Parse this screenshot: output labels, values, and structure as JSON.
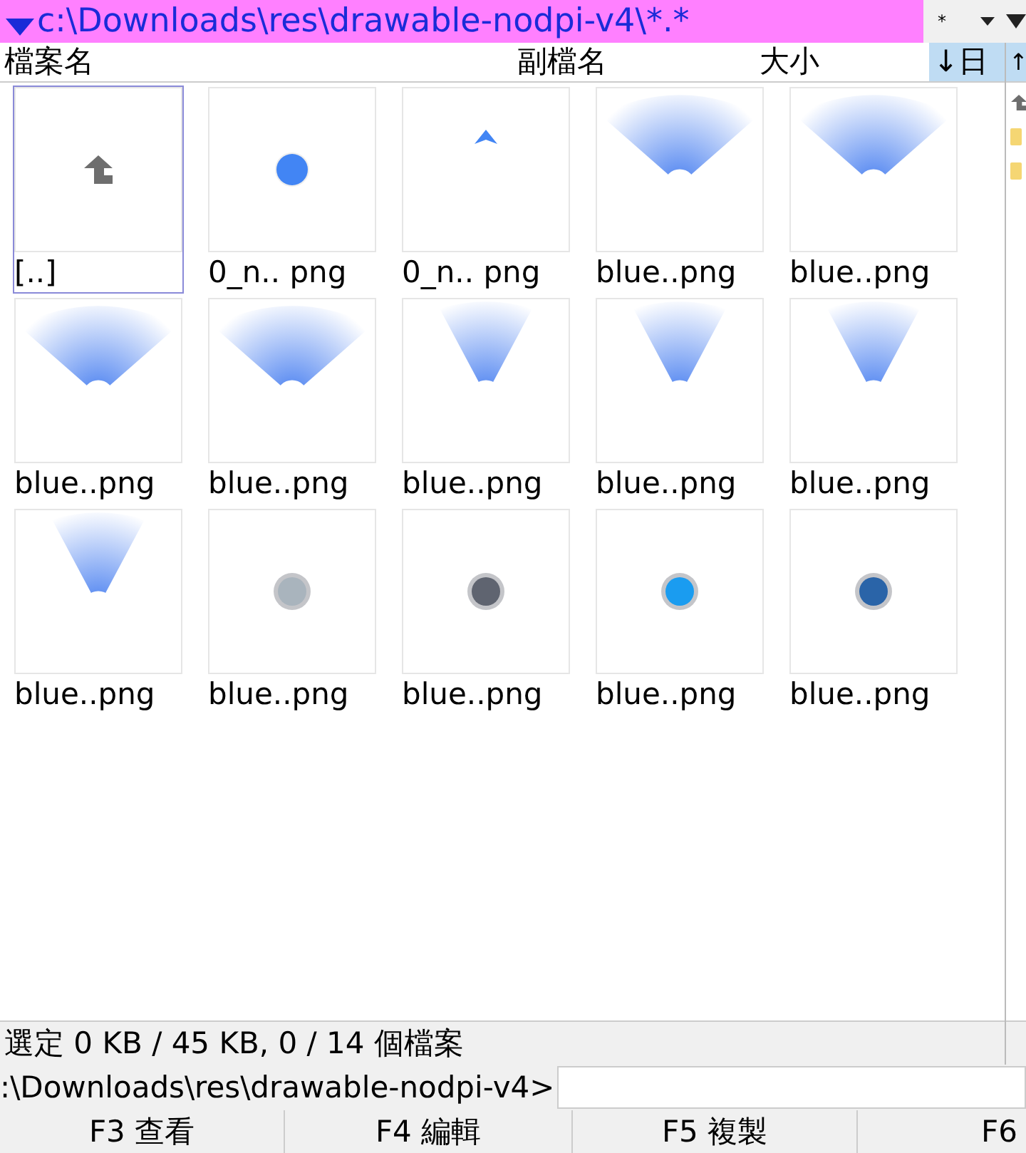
{
  "path_bar": {
    "path": "c:\\Downloads\\res\\drawable-nodpi-v4\\*.*",
    "filter": "*"
  },
  "columns": [
    {
      "label": "檔案名",
      "sorted": false
    },
    {
      "label": "副檔名",
      "sorted": false
    },
    {
      "label": "大小",
      "sorted": false
    },
    {
      "label": "↓日",
      "sorted": true
    }
  ],
  "files": [
    {
      "name": "[..]",
      "kind": "up",
      "selected": true
    },
    {
      "name": "0_n.. png",
      "kind": "dot",
      "color": "#4285f4",
      "selected": false
    },
    {
      "name": "0_n.. png",
      "kind": "triangle",
      "selected": false
    },
    {
      "name": "blue..png",
      "kind": "fan-wide",
      "selected": false
    },
    {
      "name": "blue..png",
      "kind": "fan-wide",
      "selected": false
    },
    {
      "name": "blue..png",
      "kind": "fan-wide",
      "selected": false
    },
    {
      "name": "blue..png",
      "kind": "fan-wide",
      "selected": false
    },
    {
      "name": "blue..png",
      "kind": "fan-narrow",
      "selected": false
    },
    {
      "name": "blue..png",
      "kind": "fan-narrow",
      "selected": false
    },
    {
      "name": "blue..png",
      "kind": "fan-narrow",
      "selected": false
    },
    {
      "name": "blue..png",
      "kind": "fan-narrow",
      "selected": false
    },
    {
      "name": "blue..png",
      "kind": "ring-dot",
      "color": "#a9b4bd",
      "selected": false
    },
    {
      "name": "blue..png",
      "kind": "ring-dot",
      "color": "#5f6470",
      "selected": false
    },
    {
      "name": "blue..png",
      "kind": "ring-dot",
      "color": "#1a9cf0",
      "selected": false
    },
    {
      "name": "blue..png",
      "kind": "ring-dot",
      "color": "#2a64a8",
      "selected": false
    }
  ],
  "status": "選定 0 KB / 45 KB, 0 / 14 個檔案",
  "right_panel": {
    "header": "↑"
  },
  "command_line": {
    "prompt": ":\\Downloads\\res\\drawable-nodpi-v4>"
  },
  "function_keys": [
    "F3 查看",
    "F4 編輯",
    "F5 複製",
    "F6"
  ]
}
